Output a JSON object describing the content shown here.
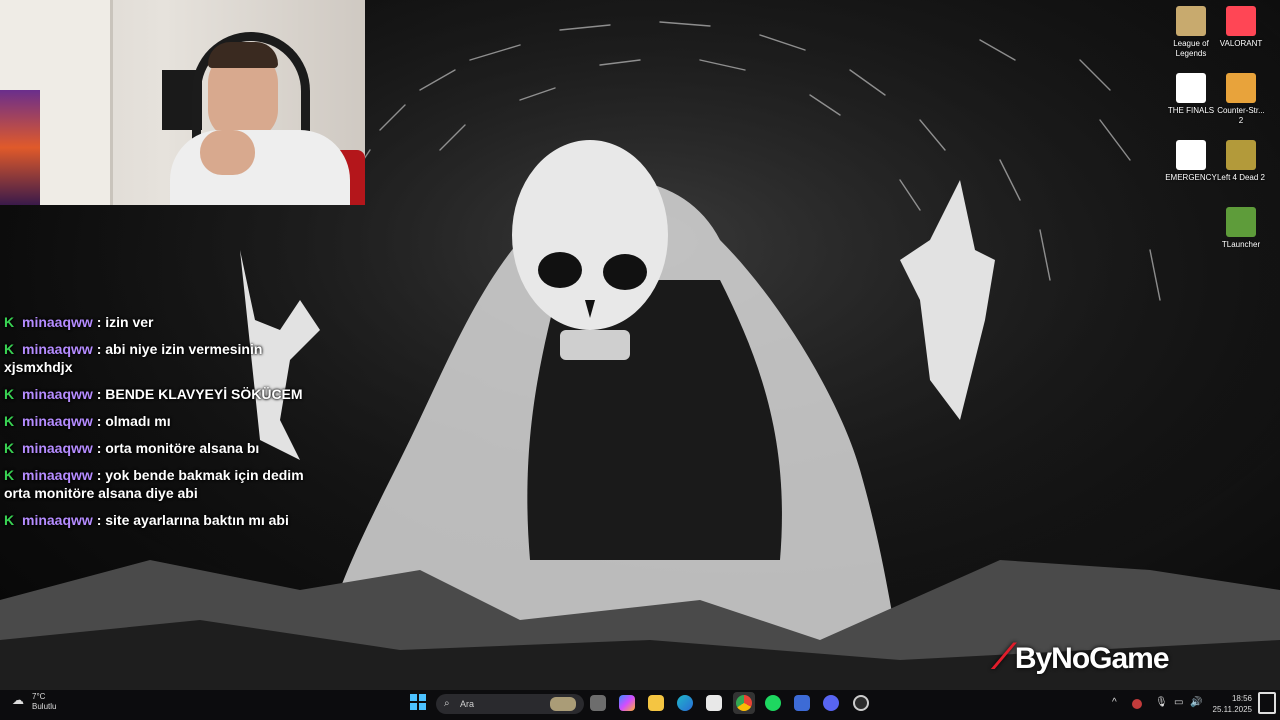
{
  "chat": {
    "messages": [
      {
        "user": "minaaqww",
        "text": ": izin ver"
      },
      {
        "user": "minaaqww",
        "text": ": abi niye izin vermesinin xjsmxhdjx"
      },
      {
        "user": "minaaqww",
        "text": ": BENDE KLAVYEYİ SÖKÜCEM"
      },
      {
        "user": "minaaqww",
        "text": ": olmadı mı"
      },
      {
        "user": "minaaqww",
        "text": ": orta monitöre alsana bı"
      },
      {
        "user": "minaaqww",
        "text": ": yok bende bakmak için dedim orta monitöre alsana diye abi"
      },
      {
        "user": "minaaqww",
        "text": ": site ayarlarına baktın mı abi"
      }
    ],
    "badge": "K"
  },
  "desktop_icons": [
    {
      "label": "League of Legends",
      "icon": "league-of-legends-icon",
      "color": "#c8aa6e"
    },
    {
      "label": "VALORANT",
      "icon": "valorant-icon",
      "color": "#ff4655"
    },
    {
      "label": "THE FINALS",
      "icon": "the-finals-icon",
      "color": "#ffffff"
    },
    {
      "label": "Counter-Str... 2",
      "icon": "counter-strike-icon",
      "color": "#e8a33b"
    },
    {
      "label": "EMERGENCY",
      "icon": "emergency-icon",
      "color": "#ffffff"
    },
    {
      "label": "Left 4 Dead 2",
      "icon": "left4dead-icon",
      "color": "#b39a3a"
    },
    {
      "label": "TLauncher",
      "icon": "tlauncher-icon",
      "color": "#5e9c3a"
    }
  ],
  "watermark": "ByNoGame",
  "taskbar": {
    "weather_temp": "7°C",
    "weather_desc": "Bulutlu",
    "search_placeholder": "Ara",
    "time": "18:56",
    "date": "25.11.2025",
    "apps": [
      "start-icon",
      "search-icon",
      "task-view-icon",
      "copilot-icon",
      "file-explorer-icon",
      "edge-icon",
      "store-icon",
      "chrome-icon",
      "spotify-icon",
      "app-icon",
      "discord-icon",
      "obs-icon"
    ]
  }
}
